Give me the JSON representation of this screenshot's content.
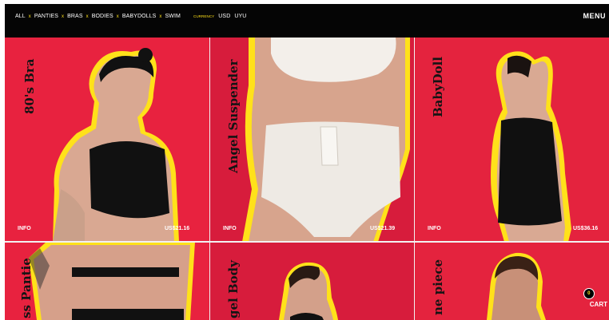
{
  "nav": {
    "items": [
      "ALL",
      "PANTIES",
      "BRAS",
      "BODIES",
      "BABYDOLLS",
      "SWIM"
    ],
    "separator": "x",
    "currency_label": "CURRENCY",
    "currencies": [
      "USD",
      "UYU"
    ],
    "menu_label": "MENU"
  },
  "products": [
    {
      "title": "80's Bra",
      "info": "INFO",
      "price": "US$21.16"
    },
    {
      "title": "Angel Suspender",
      "info": "INFO",
      "price": "US$21.39"
    },
    {
      "title": "BabyDoll",
      "info": "INFO",
      "price": "US$36.16"
    },
    {
      "title": "ss Pantie"
    },
    {
      "title": "gel Body"
    },
    {
      "title": "ne piece"
    }
  ],
  "cart": {
    "label": "CART",
    "count": "0"
  },
  "colors": {
    "background_dark": "#050505",
    "tile_red": "#e8223f",
    "tile_red_alt": "#d71c3c",
    "accent_yellow": "#ffe11a",
    "title_text": "#141414"
  }
}
